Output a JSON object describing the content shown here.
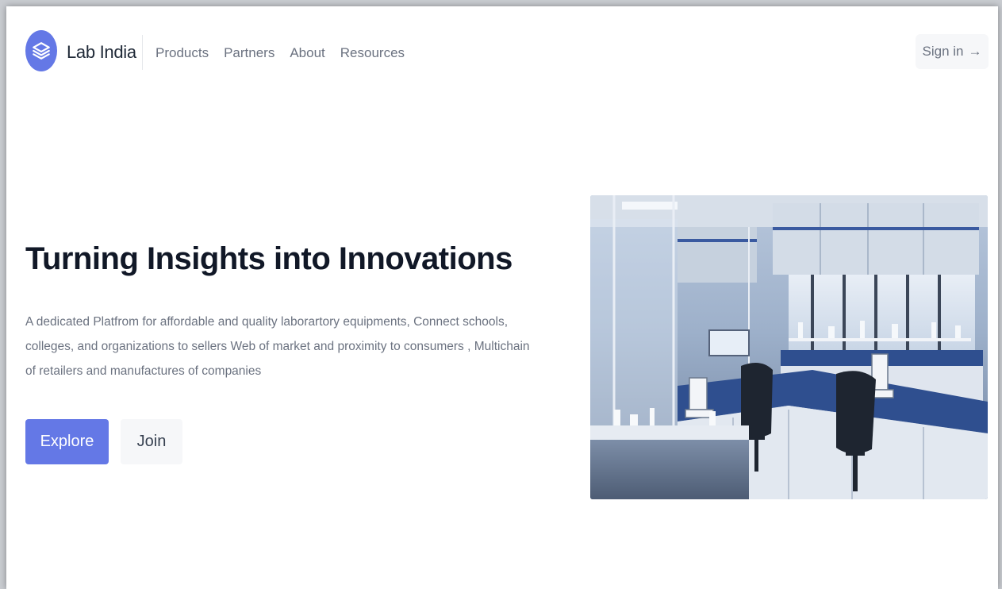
{
  "brand": {
    "name": "Lab India",
    "logo_icon": "layers-icon",
    "accent_color": "#6478e6"
  },
  "nav": {
    "items": [
      {
        "label": "Products"
      },
      {
        "label": "Partners"
      },
      {
        "label": "About"
      },
      {
        "label": "Resources"
      }
    ]
  },
  "header": {
    "signin_label": "Sign in",
    "signin_icon": "arrow-right-icon"
  },
  "hero": {
    "title": "Turning Insights into Innovations",
    "description": "A dedicated Platfrom for affordable and quality laborartory equipments, Connect schools, colleges, and organizations to sellers Web of market and proximity to consumers , Multichain of retailers and manufactures of companies",
    "explore_label": "Explore",
    "join_label": "Join"
  }
}
